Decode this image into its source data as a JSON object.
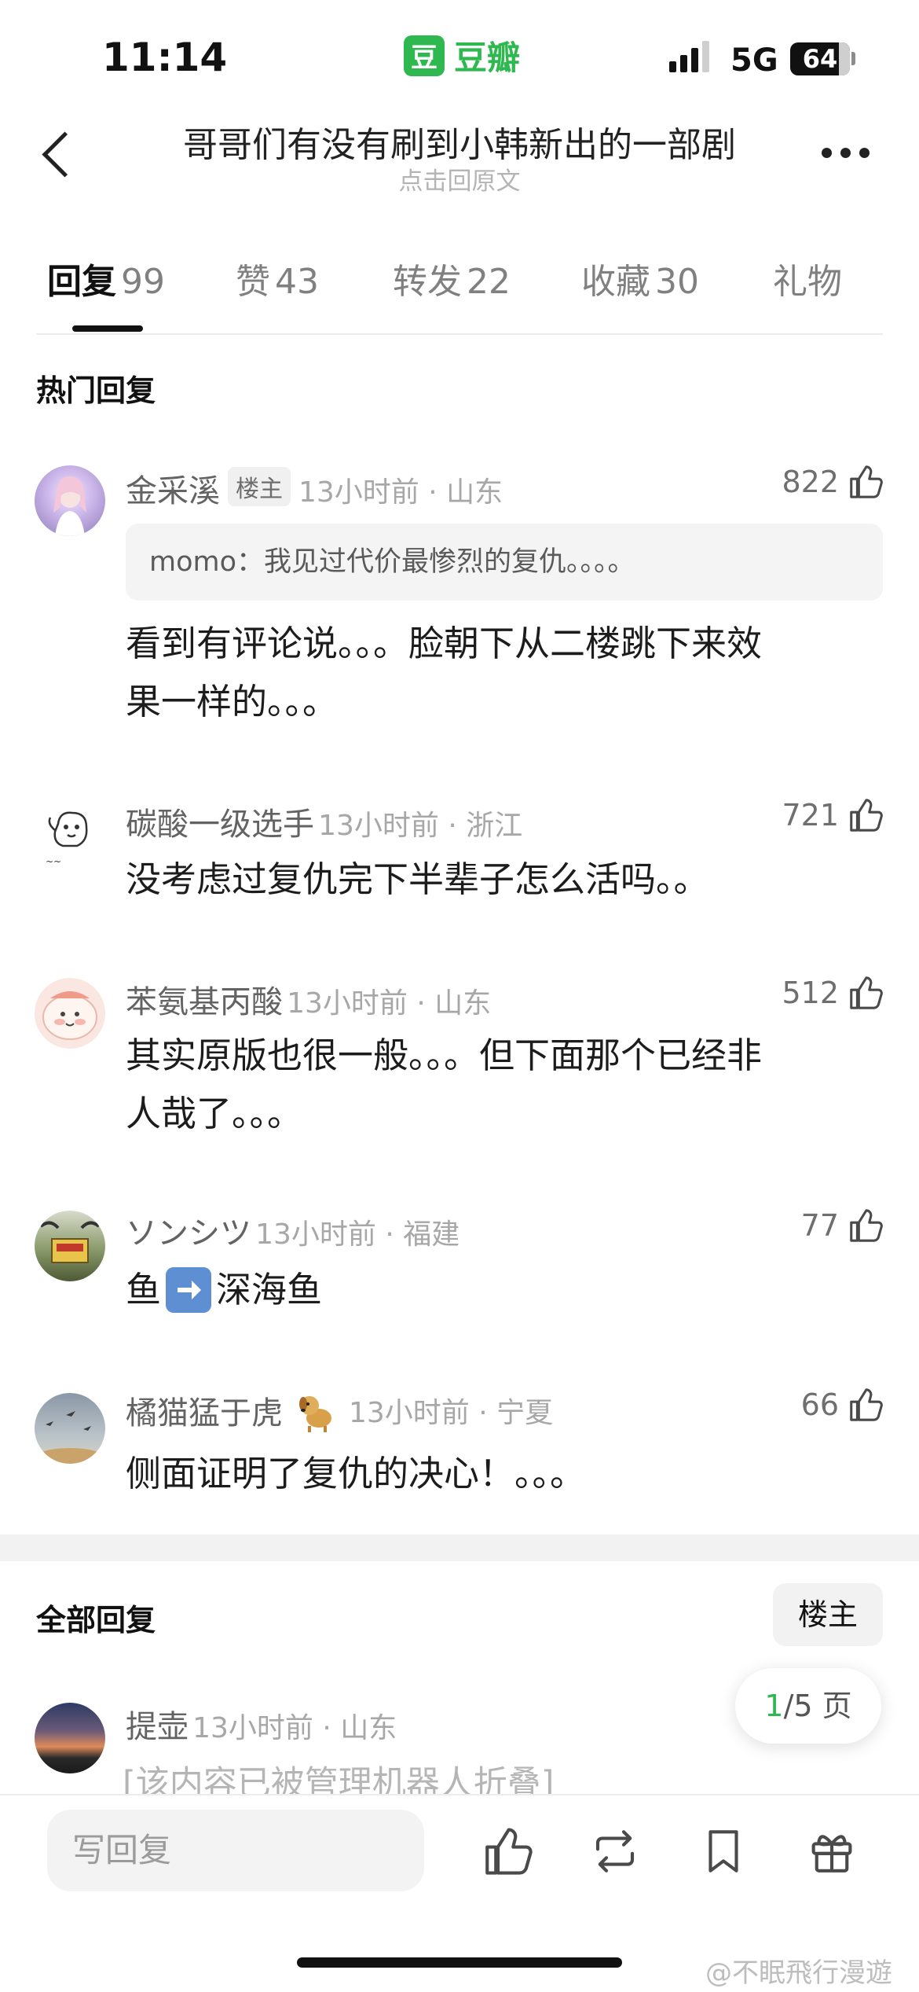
{
  "status_bar": {
    "time": "11:14",
    "app_logo_char": "豆",
    "app_name": "豆瓣",
    "network": "5G",
    "battery": "64"
  },
  "nav": {
    "title": "哥哥们有没有刷到小韩新出的一部剧",
    "subtitle": "点击回原文"
  },
  "tabs": [
    {
      "label": "回复",
      "count": "99",
      "active": true
    },
    {
      "label": "赞",
      "count": "43"
    },
    {
      "label": "转发",
      "count": "22"
    },
    {
      "label": "收藏",
      "count": "30"
    },
    {
      "label": "礼物",
      "count": ""
    }
  ],
  "hot_section_title": "热门回复",
  "hot_comments": [
    {
      "user": "金采溪",
      "badge": "楼主",
      "meta": "13小时前 · 山东",
      "likes": "822",
      "quote": "momo：我见过代价最惨烈的复仇。。。。",
      "lines": [
        "看到有评论说。。。脸朝下从二楼跳下来效",
        "果一样的。。。"
      ]
    },
    {
      "user": "碳酸一级选手",
      "meta": "13小时前 · 浙江",
      "likes": "721",
      "lines": [
        "没考虑过复仇完下半辈子怎么活吗。。"
      ]
    },
    {
      "user": "苯氨基丙酸",
      "meta": "13小时前 · 山东",
      "likes": "512",
      "lines": [
        "其实原版也很一般。。。但下面那个已经非",
        "人哉了。。。"
      ]
    },
    {
      "user": "ソンシツ",
      "meta": "13小时前 · 福建",
      "likes": "77",
      "text_before": "鱼",
      "emoji_label": "右箭头",
      "text_after": "深海鱼"
    },
    {
      "user": "橘猫猛于虎",
      "meta": "13小时前 · 宁夏",
      "likes": "66",
      "lines": [
        "侧面证明了复仇的决心！。。。"
      ]
    }
  ],
  "all_section_title": "全部回复",
  "op_filter": "楼主",
  "pagination": {
    "current": "1",
    "total_text": "/5 页"
  },
  "all_comments": [
    {
      "user": "提壶",
      "meta": "13小时前 · 山东",
      "text": "[该内容已被管理机器人折叠]"
    }
  ],
  "bottom_bar": {
    "reply_placeholder": "写回复"
  },
  "watermark": "@不眠飛行漫遊",
  "colors": {
    "accent": "#2fb84f",
    "text_primary": "#1c1c1c",
    "text_meta": "#a7a7a7"
  }
}
